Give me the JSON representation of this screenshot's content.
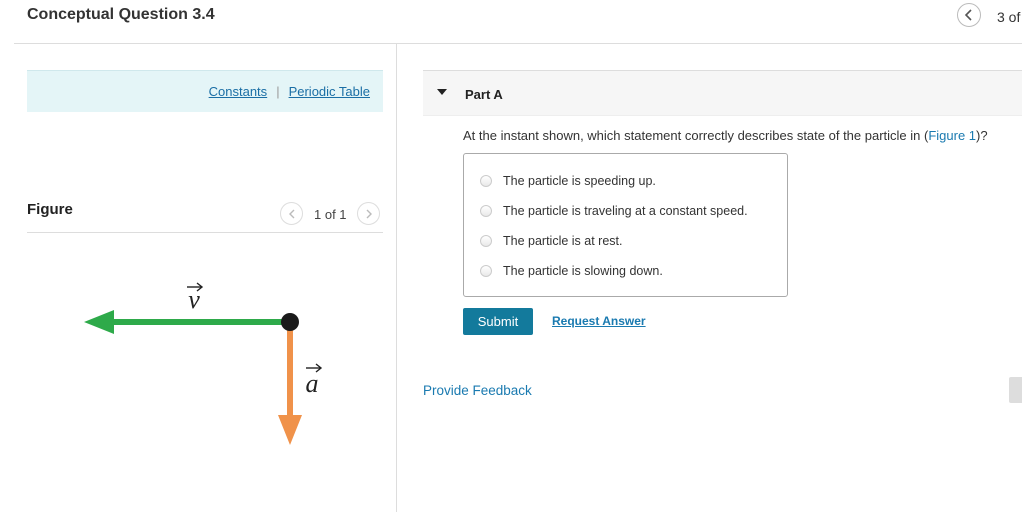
{
  "header": {
    "title": "Conceptual Question 3.4",
    "nav_prev_icon": "chevron-left-icon",
    "nav_count": "3 of"
  },
  "resources": {
    "constants": "Constants",
    "separator": "|",
    "periodic_table": "Periodic Table"
  },
  "figure": {
    "label": "Figure",
    "counter": "1 of 1",
    "velocity_symbol": "v",
    "acceleration_symbol": "a",
    "colors": {
      "velocity": "#2eaa4a",
      "acceleration": "#f0924a",
      "particle": "#1a1a1a"
    }
  },
  "part": {
    "label": "Part A",
    "question_prefix": "At the instant shown, which statement correctly describes state of the particle in (",
    "question_link": "Figure 1",
    "question_suffix": ")?",
    "choices": [
      "The particle is speeding up.",
      "The particle is traveling at a constant speed.",
      "The particle is at rest.",
      "The particle is slowing down."
    ],
    "submit_label": "Submit",
    "request_label": "Request Answer"
  },
  "footer": {
    "feedback_label": "Provide Feedback"
  },
  "colors": {
    "accent": "#137a9c",
    "link": "#1a7ab0",
    "resources_bg": "#e4f5f7"
  }
}
